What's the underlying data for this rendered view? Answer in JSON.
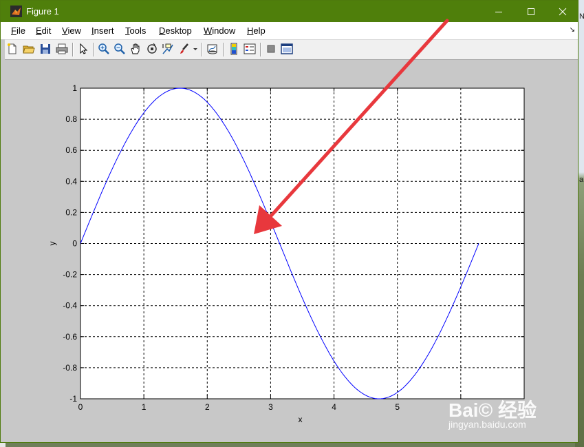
{
  "window": {
    "title": "Figure 1"
  },
  "menu": {
    "file": {
      "u": "F",
      "rest": "ile"
    },
    "edit": {
      "u": "E",
      "rest": "dit"
    },
    "view": {
      "u": "V",
      "rest": "iew"
    },
    "insert": {
      "u": "I",
      "rest": "nsert"
    },
    "tools": {
      "u": "T",
      "rest": "ools"
    },
    "desktop": {
      "u": "D",
      "rest": "esktop"
    },
    "window": {
      "u": "W",
      "rest": "indow"
    },
    "help": {
      "u": "H",
      "rest": "elp"
    }
  },
  "toolbar": {
    "icons": [
      "new-figure-icon",
      "open-icon",
      "save-icon",
      "print-icon",
      "pointer-icon",
      "zoom-in-icon",
      "zoom-out-icon",
      "pan-icon",
      "rotate-icon",
      "data-cursor-icon",
      "brush-icon",
      "link-icon",
      "colorbar-icon",
      "legend-icon",
      "hide-tools-icon",
      "show-tools-icon"
    ]
  },
  "chart_data": {
    "type": "line",
    "function": "sin(x)",
    "x": [
      0,
      0.25,
      0.5,
      0.75,
      1,
      1.25,
      1.5,
      1.5708,
      1.75,
      2,
      2.25,
      2.5,
      2.75,
      3,
      3.1416,
      3.25,
      3.5,
      3.75,
      4,
      4.25,
      4.5,
      4.7124,
      5,
      5.25,
      5.5,
      5.75,
      6,
      6.2832
    ],
    "y": [
      0,
      0.247,
      0.479,
      0.682,
      0.841,
      0.949,
      0.997,
      1,
      0.984,
      0.909,
      0.778,
      0.598,
      0.382,
      0.141,
      0,
      -0.108,
      -0.351,
      -0.572,
      -0.757,
      -0.895,
      -0.978,
      -1,
      -0.959,
      -0.859,
      -0.706,
      -0.508,
      -0.279,
      0
    ],
    "xlabel": "x",
    "ylabel": "y",
    "xlim": [
      0,
      7
    ],
    "ylim": [
      -1,
      1
    ],
    "xticks": [
      "0",
      "1",
      "2",
      "3",
      "4",
      "5"
    ],
    "yticks": [
      "-1",
      "-0.8",
      "-0.6",
      "-0.4",
      "-0.2",
      "0",
      "0.2",
      "0.4",
      "0.6",
      "0.8",
      "1"
    ],
    "grid": true,
    "line_color": "#0000ff",
    "annotation": "red arrow pointing at the curve"
  },
  "watermark": {
    "logo": "Bai© 经验",
    "url": "jingyan.baidu.com"
  },
  "colors": {
    "titlebar": "#4f7f0b",
    "figure_bg": "#c8c8c8",
    "arrow": "#e8383d"
  }
}
